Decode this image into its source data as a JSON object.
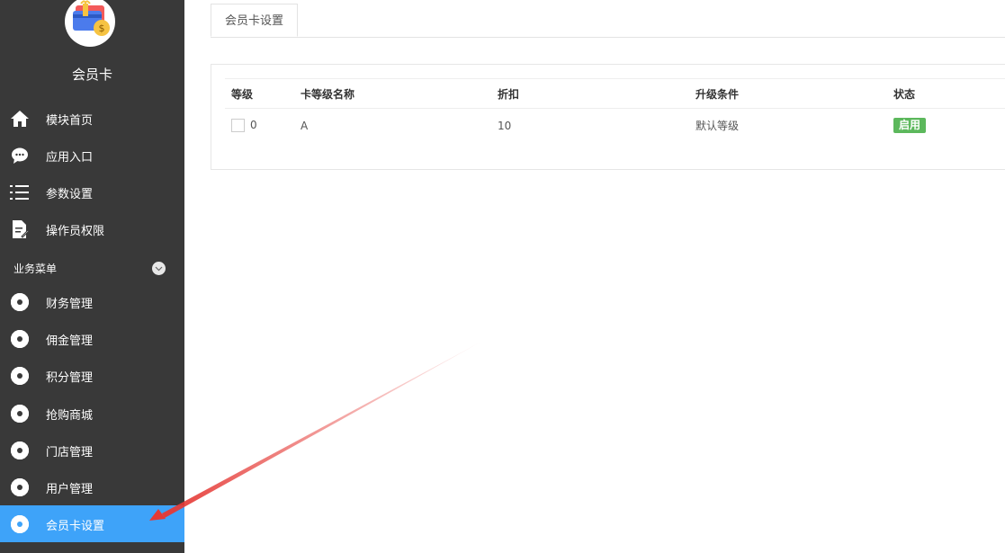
{
  "app": {
    "name": "会员卡"
  },
  "nav_top": [
    {
      "label": "模块首页",
      "icon": "home-icon"
    },
    {
      "label": "应用入口",
      "icon": "chat-icon"
    },
    {
      "label": "参数设置",
      "icon": "list-icon"
    },
    {
      "label": "操作员权限",
      "icon": "document-edit-icon"
    }
  ],
  "section": {
    "label": "业务菜单",
    "toggle_icon": "chevron-down-icon"
  },
  "nav_business": [
    {
      "label": "财务管理",
      "icon": "gear-icon"
    },
    {
      "label": "佣金管理",
      "icon": "gear-icon"
    },
    {
      "label": "积分管理",
      "icon": "gear-icon"
    },
    {
      "label": "抢购商城",
      "icon": "gear-icon"
    },
    {
      "label": "门店管理",
      "icon": "gear-icon"
    },
    {
      "label": "用户管理",
      "icon": "gear-icon"
    },
    {
      "label": "会员卡设置",
      "icon": "gear-icon",
      "active": true
    }
  ],
  "tabs": [
    {
      "label": "会员卡设置"
    }
  ],
  "table": {
    "columns": [
      "等级",
      "卡等级名称",
      "折扣",
      "升级条件",
      "状态"
    ],
    "rows": [
      {
        "level": "0",
        "name": "A",
        "discount": "10",
        "condition": "默认等级",
        "status": "启用"
      }
    ]
  },
  "colors": {
    "sidebar_bg": "#393939",
    "active_item_bg": "#3ea3f9",
    "status_enabled": "#5cb85c",
    "annotation_arrow": "#e53935"
  }
}
